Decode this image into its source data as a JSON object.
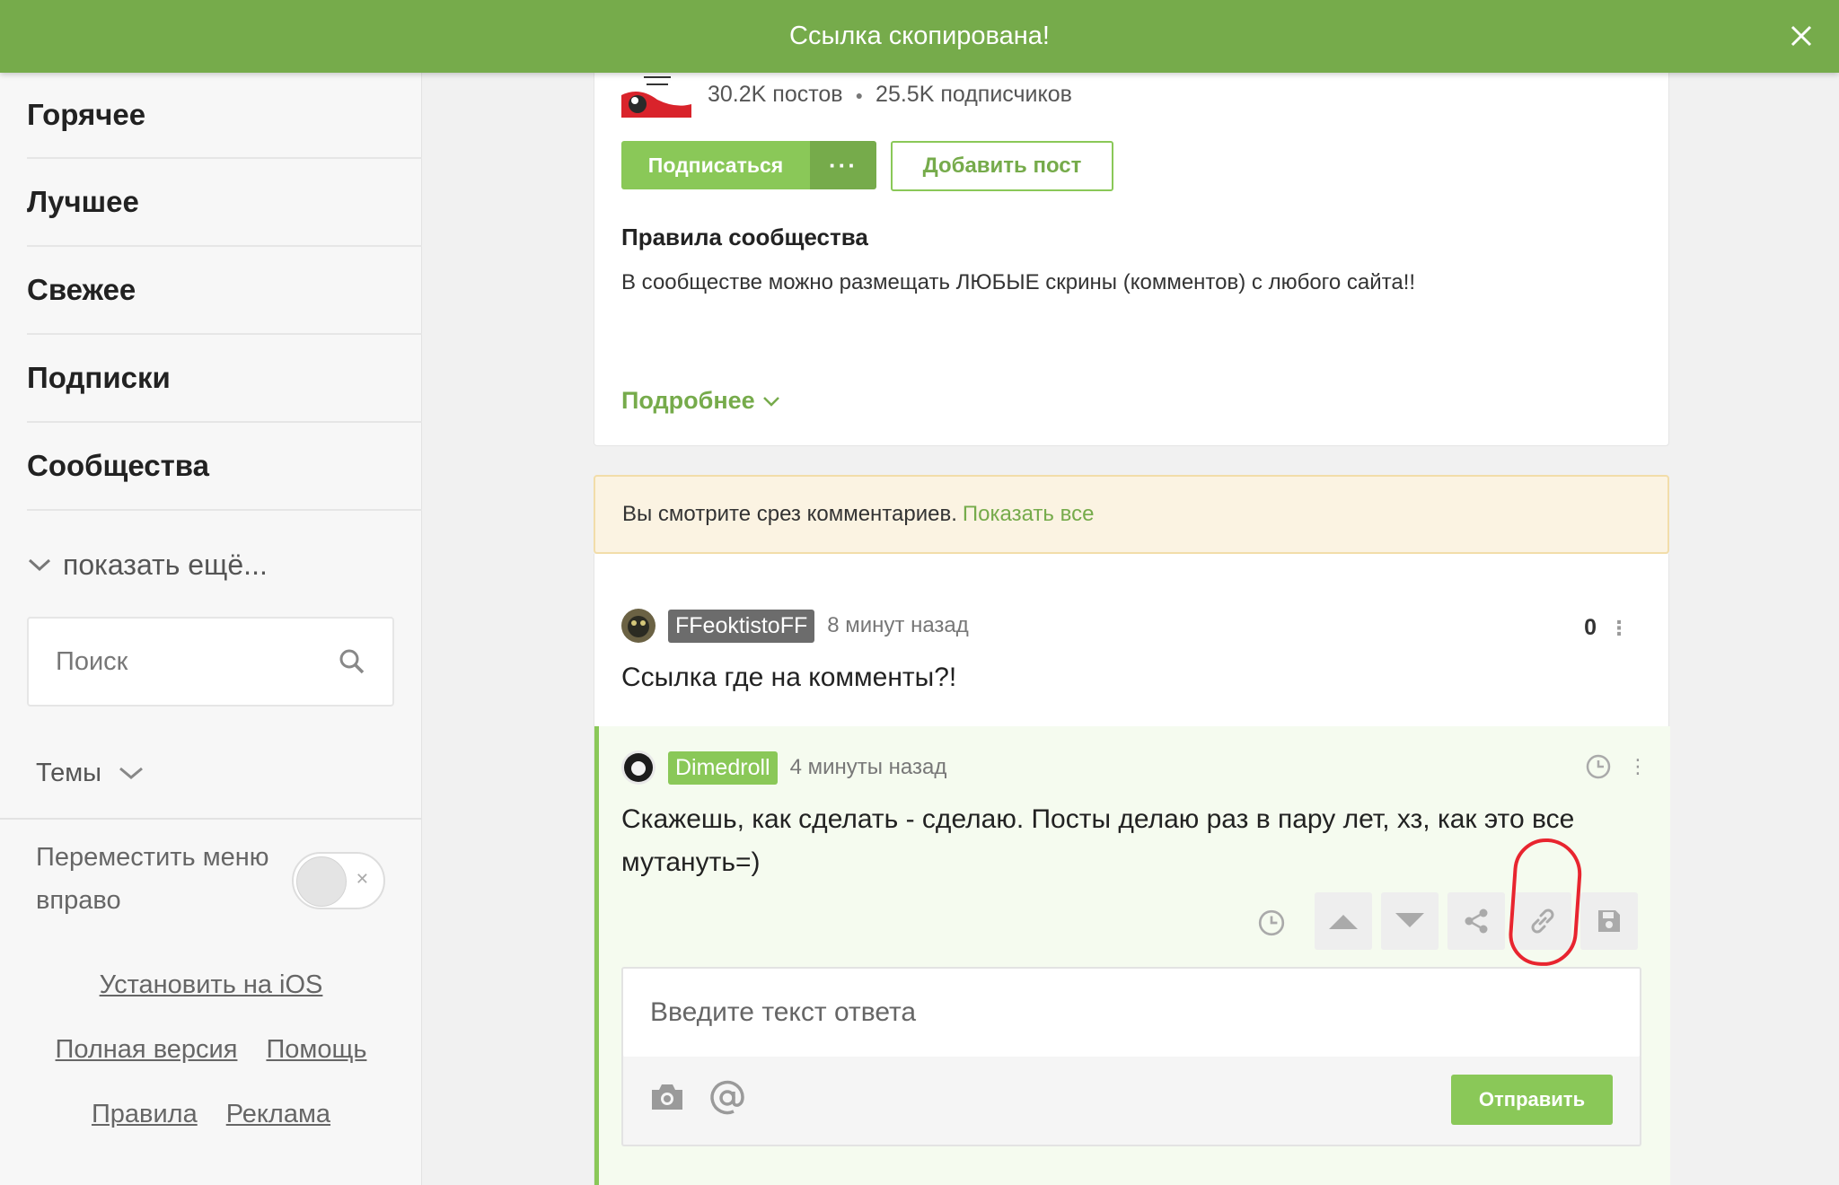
{
  "toast": {
    "message": "Ссылка скопирована!"
  },
  "sidebar": {
    "items": [
      {
        "label": "Горячее"
      },
      {
        "label": "Лучшее"
      },
      {
        "label": "Свежее"
      },
      {
        "label": "Подписки"
      },
      {
        "label": "Сообщества"
      }
    ],
    "show_more": "показать ещё...",
    "search_placeholder": "Поиск",
    "themes_label": "Темы",
    "move_menu_label": "Переместить меню вправо",
    "move_menu_enabled": false,
    "footer": {
      "install_ios": "Установить на iOS",
      "full_version": "Полная версия",
      "help": "Помощь",
      "rules": "Правила",
      "ads": "Реклама"
    }
  },
  "community": {
    "posts_count": "30.2K постов",
    "subscribers_count": "25.5K подписчиков",
    "subscribe_label": "Подписаться",
    "more_label": "···",
    "add_post_label": "Добавить пост",
    "rules_title": "Правила сообщества",
    "rules_text": "В сообществе можно размещать ЛЮБЫЕ скрины (комментов) с любого сайта!!",
    "more_link": "Подробнее"
  },
  "notice": {
    "text": "Вы смотрите срез комментариев.",
    "link": "Показать все"
  },
  "comments": [
    {
      "author": "FFeoktistoFF",
      "time": "8 минут назад",
      "score": "0",
      "text": "Ссылка где на комменты?!"
    },
    {
      "author": "Dimedroll",
      "time": "4 минуты назад",
      "text": "Скажешь, как сделать - сделаю. Посты делаю раз в пару лет, хз, как это все мутануть=)"
    }
  ],
  "reply": {
    "placeholder": "Введите текст ответа",
    "send_label": "Отправить"
  },
  "colors": {
    "brand_green": "#8ac858",
    "toast_green": "#76ab4b",
    "notice_bg": "#fbf3e2",
    "highlight_red": "#e8252f"
  },
  "icons": [
    "close-icon",
    "chevron-down-icon",
    "search-icon",
    "clock-icon",
    "upvote-icon",
    "downvote-icon",
    "share-icon",
    "link-icon",
    "save-icon",
    "camera-icon",
    "at-icon",
    "kebab-icon"
  ]
}
